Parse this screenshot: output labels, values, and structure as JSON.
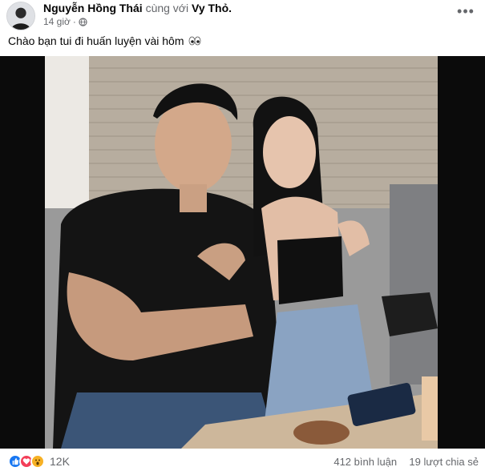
{
  "post": {
    "author": "Nguyễn Hồng Thái",
    "with_text": "cùng với",
    "tagged": "Vy Thỏ.",
    "time": "14 giờ",
    "separator": "·",
    "more_label": "•••",
    "text": "Chào bạn tui đi huấn luyện vài hôm"
  },
  "footer": {
    "reaction_count": "12K",
    "comments": "412 bình luận",
    "shares": "19 lượt chia sẻ"
  },
  "icons": {
    "reactions": [
      "like-icon",
      "love-icon",
      "wow-icon"
    ],
    "emoji": "eyes-icon",
    "privacy": "globe-icon"
  },
  "colors": {
    "like": "#1877f2",
    "love": "#f33e58",
    "wow": "#f7b125",
    "secondary_text": "#65676b"
  }
}
